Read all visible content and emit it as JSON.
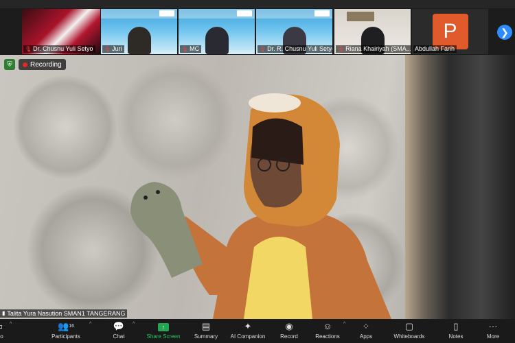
{
  "gallery": {
    "tiles": [
      {
        "name": "Dr. Chusnu Yuli Setyo",
        "muted": true
      },
      {
        "name": "Juri",
        "muted": true
      },
      {
        "name": "MC",
        "muted": true
      },
      {
        "name": "Dr. R. Chusnu Yuli Setyo",
        "muted": true
      },
      {
        "name": "Riana Khairiyah (SMA...",
        "muted": true
      },
      {
        "name": "Abdullah Farih",
        "muted": false,
        "avatar_letter": "P"
      }
    ],
    "next_icon": "chevron-right-icon"
  },
  "main_video": {
    "recording_label": "Recording",
    "speaker_name": "Talita Yura Nasution SMAN1 TANGERANG"
  },
  "toolbar": {
    "items": [
      {
        "label": "deo",
        "icon": "video-icon"
      },
      {
        "label": "Participants",
        "icon": "participants-icon",
        "count": "16"
      },
      {
        "label": "Chat",
        "icon": "chat-icon"
      },
      {
        "label": "Share Screen",
        "icon": "share-screen-icon"
      },
      {
        "label": "Summary",
        "icon": "summary-icon"
      },
      {
        "label": "AI Companion",
        "icon": "ai-companion-icon"
      },
      {
        "label": "Record",
        "icon": "record-icon"
      },
      {
        "label": "Reactions",
        "icon": "reactions-icon"
      },
      {
        "label": "Apps",
        "icon": "apps-icon"
      },
      {
        "label": "Whiteboards",
        "icon": "whiteboards-icon"
      },
      {
        "label": "Notes",
        "icon": "notes-icon"
      },
      {
        "label": "More",
        "icon": "more-icon"
      }
    ]
  },
  "colors": {
    "share_green": "#23a551",
    "record_red": "#e02828",
    "accent_blue": "#2d8cff",
    "avatar_orange": "#e05a2b"
  }
}
